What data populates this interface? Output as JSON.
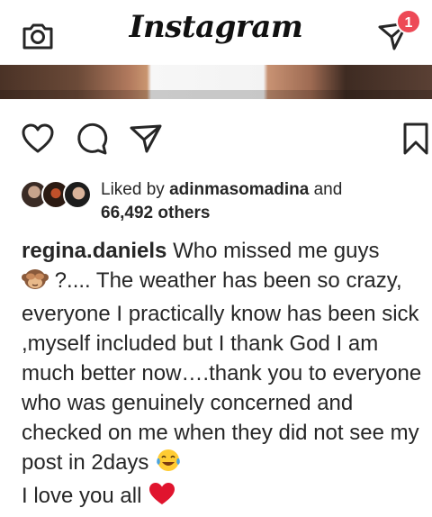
{
  "header": {
    "logo": "Instagram",
    "dm_badge": "1"
  },
  "post": {
    "liked_by_prefix": "Liked by",
    "liked_by_user": "adinmasomadina",
    "liked_by_and": "and",
    "likes_count": "66,492 others",
    "caption_user": "regina.daniels",
    "caption_text_1": "Who missed me guys",
    "caption_text_2": "?.... The weather has been so crazy, everyone I practically know has been sick ,myself included but I thank God I am much better now….thank you to everyone who was genuinely concerned and checked on me when they did not see my post in 2days",
    "caption_text_3": "I love you all"
  },
  "icons": [
    "camera-icon",
    "direct-message-icon",
    "heart-icon",
    "comment-icon",
    "share-icon",
    "bookmark-icon",
    "see-no-evil-monkey-emoji",
    "tears-of-joy-emoji",
    "red-heart-emoji"
  ]
}
